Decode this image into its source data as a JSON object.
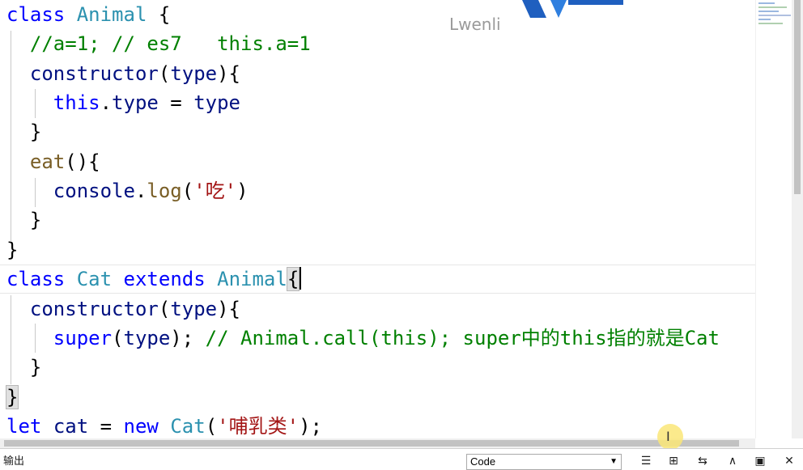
{
  "watermark": "Lwenli",
  "code_lines": [
    [
      {
        "t": "class",
        "c": "kw"
      },
      {
        "t": " "
      },
      {
        "t": "Animal",
        "c": "cls"
      },
      {
        "t": " {"
      }
    ],
    [
      {
        "t": "  "
      },
      {
        "t": "//a=1; // es7   this.a=1",
        "c": "com"
      }
    ],
    [
      {
        "t": "  "
      },
      {
        "t": "constructor",
        "c": "var"
      },
      {
        "t": "("
      },
      {
        "t": "type",
        "c": "var"
      },
      {
        "t": "){"
      }
    ],
    [
      {
        "t": "    "
      },
      {
        "t": "this",
        "c": "kw"
      },
      {
        "t": "."
      },
      {
        "t": "type",
        "c": "var"
      },
      {
        "t": " = "
      },
      {
        "t": "type",
        "c": "var"
      }
    ],
    [
      {
        "t": "  }"
      }
    ],
    [
      {
        "t": "  "
      },
      {
        "t": "eat",
        "c": "fn"
      },
      {
        "t": "(){"
      }
    ],
    [
      {
        "t": "    "
      },
      {
        "t": "console",
        "c": "var"
      },
      {
        "t": "."
      },
      {
        "t": "log",
        "c": "fn"
      },
      {
        "t": "("
      },
      {
        "t": "'吃'",
        "c": "str"
      },
      {
        "t": ")"
      }
    ],
    [
      {
        "t": "  }"
      }
    ],
    [
      {
        "t": "}"
      }
    ],
    [
      {
        "t": "class",
        "c": "kw"
      },
      {
        "t": " "
      },
      {
        "t": "Cat",
        "c": "cls"
      },
      {
        "t": " "
      },
      {
        "t": "extends",
        "c": "kw"
      },
      {
        "t": " "
      },
      {
        "t": "Animal",
        "c": "cls"
      },
      {
        "t": "{",
        "c": "brace-hl"
      },
      {
        "t": "",
        "c": "caret"
      }
    ],
    [
      {
        "t": "  "
      },
      {
        "t": "constructor",
        "c": "var"
      },
      {
        "t": "("
      },
      {
        "t": "type",
        "c": "var"
      },
      {
        "t": "){"
      }
    ],
    [
      {
        "t": "    "
      },
      {
        "t": "super",
        "c": "kw"
      },
      {
        "t": "("
      },
      {
        "t": "type",
        "c": "var"
      },
      {
        "t": "); "
      },
      {
        "t": "// Animal.call(this); super中的this指的就是Cat",
        "c": "com"
      }
    ],
    [
      {
        "t": "  }"
      }
    ],
    [
      {
        "t": "}",
        "c": "brace-hl"
      }
    ],
    [
      {
        "t": "let",
        "c": "kw"
      },
      {
        "t": " "
      },
      {
        "t": "cat",
        "c": "var"
      },
      {
        "t": " = "
      },
      {
        "t": "new",
        "c": "kw"
      },
      {
        "t": " "
      },
      {
        "t": "Cat",
        "c": "cls"
      },
      {
        "t": "("
      },
      {
        "t": "'哺乳类'",
        "c": "str"
      },
      {
        "t": ");"
      }
    ]
  ],
  "output_panel": {
    "title": "输出",
    "source_value": "Code",
    "buttons": [
      {
        "name": "clear-all-icon",
        "glyph": "☰",
        "label": ""
      },
      {
        "name": "lock-scroll-icon",
        "glyph": "⊞",
        "label": ""
      },
      {
        "name": "word-wrap-icon",
        "glyph": "⇆",
        "label": ""
      },
      {
        "name": "chevron-up-icon",
        "glyph": "∧",
        "label": ""
      },
      {
        "name": "maximize-icon",
        "glyph": "▣",
        "label": ""
      },
      {
        "name": "close-icon",
        "glyph": "✕",
        "label": ""
      }
    ]
  },
  "colors": {
    "keyword": "#0000ff",
    "class": "#2b91af",
    "comment": "#008000",
    "string": "#a31515",
    "variable": "#001080",
    "function": "#795e26"
  }
}
